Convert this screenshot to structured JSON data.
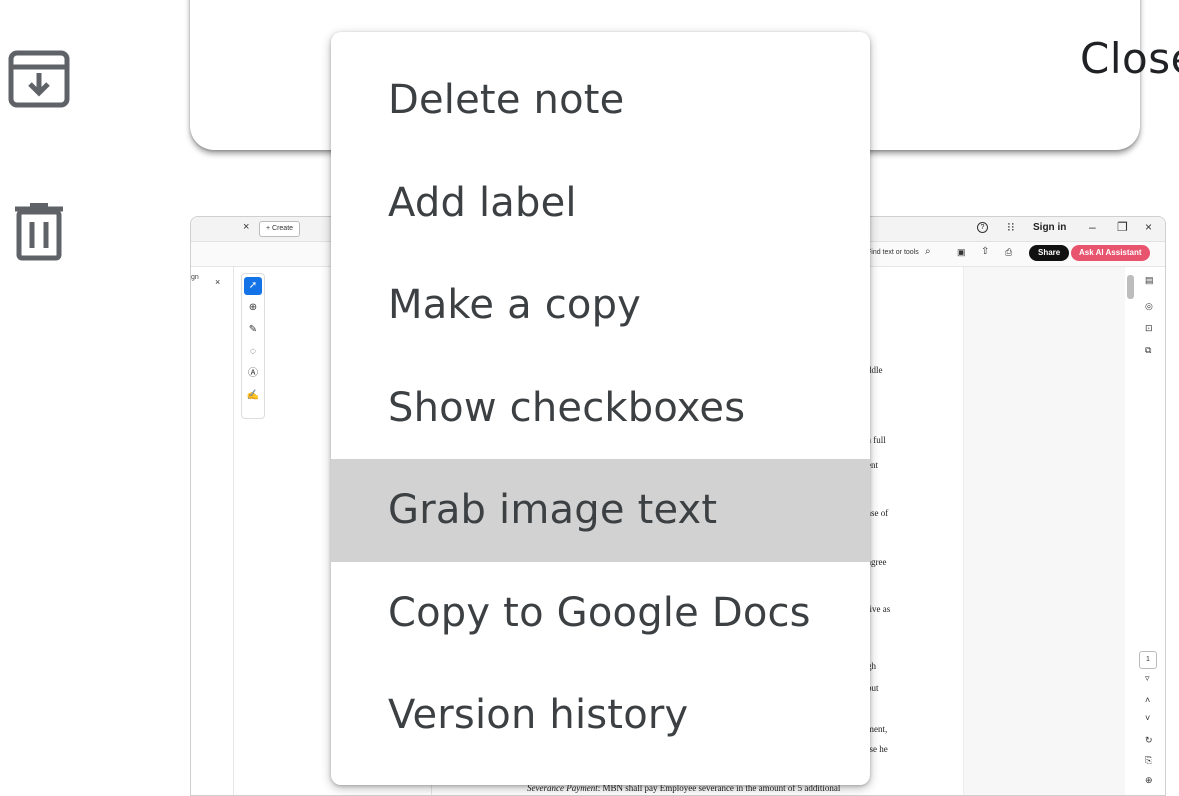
{
  "rail": {
    "archive_icon": "archive-icon",
    "delete_icon": "trash-icon"
  },
  "dialog": {
    "close_label": "Close"
  },
  "menu": {
    "items": [
      {
        "label": "Delete note"
      },
      {
        "label": "Add label"
      },
      {
        "label": "Make a copy"
      },
      {
        "label": "Show checkboxes"
      },
      {
        "label": "Grab image text",
        "highlighted": true
      },
      {
        "label": "Copy to Google Docs"
      },
      {
        "label": "Version history"
      }
    ]
  },
  "screenshot": {
    "tab_close": "×",
    "create_label": "+ Create",
    "sign_fragment": "gn",
    "panel_close": "×",
    "sign_in": "Sign in",
    "find_placeholder": "Find text or tools",
    "share_label": "Share",
    "ai_label": "Ask AI Assistant",
    "page_number": "1",
    "doc_fragments": [
      "ddle",
      "a full",
      "ent",
      "ase of",
      ";",
      "agree",
      "tive as",
      "gh",
      "but",
      "ment,",
      "ise he"
    ],
    "severance_label": "Severance Payment",
    "severance_text": ":  MBN shall pay Employee severance in the amount of 5 additional"
  }
}
